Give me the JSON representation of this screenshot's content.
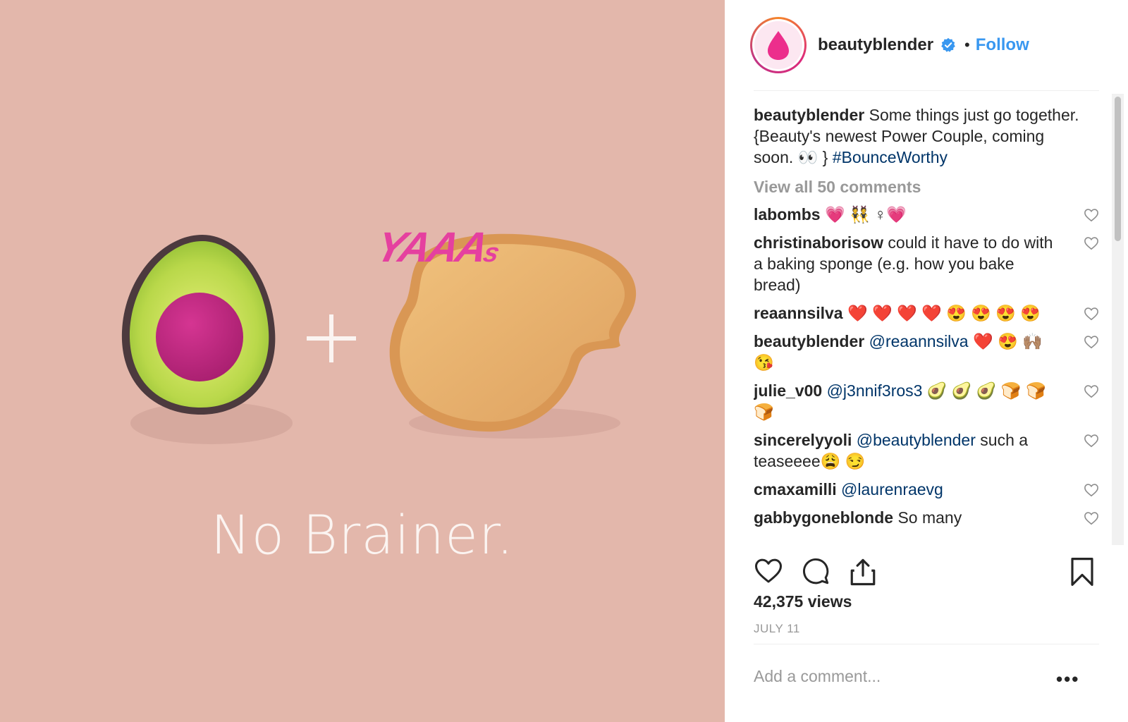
{
  "post": {
    "tagline": "No Brainer.",
    "sticker_main": "YAAA",
    "sticker_small": "s"
  },
  "header": {
    "username": "beautyblender",
    "separator": "•",
    "follow_label": "Follow"
  },
  "caption": {
    "username": "beautyblender",
    "text": " Some things just go together. {Beauty's newest Power Couple, coming soon. 👀 } ",
    "hashtag": "#BounceWorthy"
  },
  "view_all_label": "View all 50 comments",
  "comments": [
    {
      "user": "labombs",
      "mention": "",
      "text": " 💗 👯 ♀💗"
    },
    {
      "user": "christinaborisow",
      "mention": "",
      "text": " could it have to do with a baking sponge (e.g. how you bake bread)"
    },
    {
      "user": "reaannsilva",
      "mention": "",
      "text": " ❤️ ❤️ ❤️ ❤️ 😍 😍 😍 😍"
    },
    {
      "user": "beautyblender",
      "mention": " @reaannsilva",
      "text": " ❤️ 😍 🙌🏽 😘"
    },
    {
      "user": "julie_v00",
      "mention": " @j3nnif3ros3",
      "text": " 🥑 🥑 🥑 🍞 🍞 🍞"
    },
    {
      "user": "sincerelyyoli",
      "mention": " @beautyblender",
      "text": " such a teaseeee😩 😏"
    },
    {
      "user": "cmaxamilli",
      "mention": " @laurenraevg",
      "text": ""
    },
    {
      "user": "gabbygoneblonde",
      "mention": "",
      "text": " So many"
    }
  ],
  "icons": {
    "like": "heart-icon",
    "comment": "comment-icon",
    "share": "share-icon",
    "save": "bookmark-icon",
    "verified": "verified-badge-icon",
    "options": "more-options-icon"
  },
  "stats": {
    "views": "42,375 views",
    "date": "JULY 11"
  },
  "add_comment_placeholder": "Add a comment...",
  "options_glyph": "•••",
  "colors": {
    "background": "#e3b7ab",
    "accent": "#3897f0",
    "brand_pink": "#e5409f"
  }
}
